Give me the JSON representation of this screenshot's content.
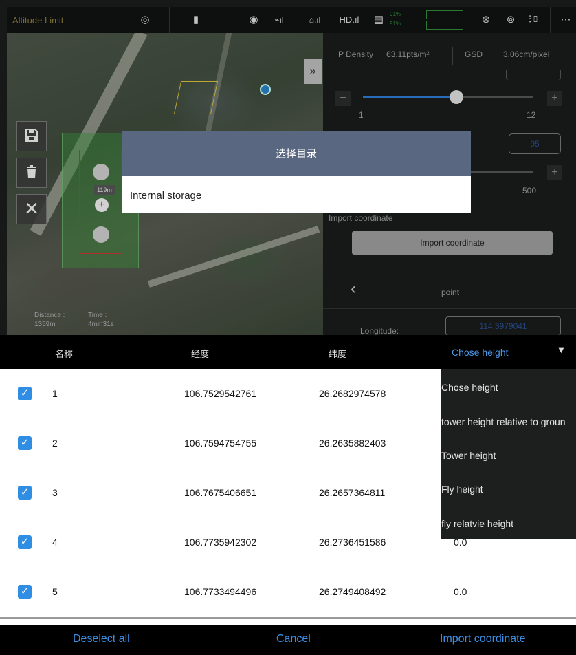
{
  "statusbar": {
    "mode_label": "Altitude Limit",
    "battery_percent_1": "91%",
    "battery_percent_2": "91%",
    "signal_hd": "HD",
    "more_icon": "more-icon"
  },
  "map": {
    "distance_label": "Distance :",
    "distance_value": "1359m",
    "time_label": "Time :",
    "time_value": "4min31s",
    "distance_badge": "119m",
    "expand_icon": "»",
    "save_icon": "save-icon",
    "delete_icon": "trash-icon",
    "close_icon": "close-icon"
  },
  "panel": {
    "p_density_label": "P Density",
    "p_density_value": "63.11pts/m²",
    "gsd_label": "GSD",
    "gsd_value": "3.06cm/pixel",
    "slider1_min": "1",
    "slider1_max": "12",
    "slider1_level": 0.55,
    "input_value": "95",
    "slider2_max": "500",
    "import_label": "Import coordinate",
    "import_button": "Import coordinate",
    "nav_title": "point",
    "longitude_label": "Longitude:",
    "longitude_value": "114.3979041"
  },
  "dialog": {
    "title": "选择目录",
    "item": "Internal storage"
  },
  "table": {
    "headers": [
      "名称",
      "经度",
      "纬度"
    ],
    "height_select": "Chose height",
    "rows": [
      {
        "name": "1",
        "lon": "106.7529542761",
        "lat": "26.2682974578",
        "height": ""
      },
      {
        "name": "2",
        "lon": "106.7594754755",
        "lat": "26.2635882403",
        "height": ""
      },
      {
        "name": "3",
        "lon": "106.7675406651",
        "lat": "26.2657364811",
        "height": ""
      },
      {
        "name": "4",
        "lon": "106.7735942302",
        "lat": "26.2736451586",
        "height": "0.0"
      },
      {
        "name": "5",
        "lon": "106.7733494496",
        "lat": "26.2749408492",
        "height": "0.0"
      }
    ]
  },
  "dropdown": {
    "options": [
      "Chose height",
      "tower height relative to groun",
      "Tower height",
      "Fly height",
      "fly relatvie height"
    ]
  },
  "footer": {
    "deselect": "Deselect all",
    "cancel": "Cancel",
    "import": "Import coordinate"
  },
  "colors": {
    "accent": "#2f8de4",
    "dialog_header": "#5a6780",
    "link_blue": "#3d8fe6"
  }
}
